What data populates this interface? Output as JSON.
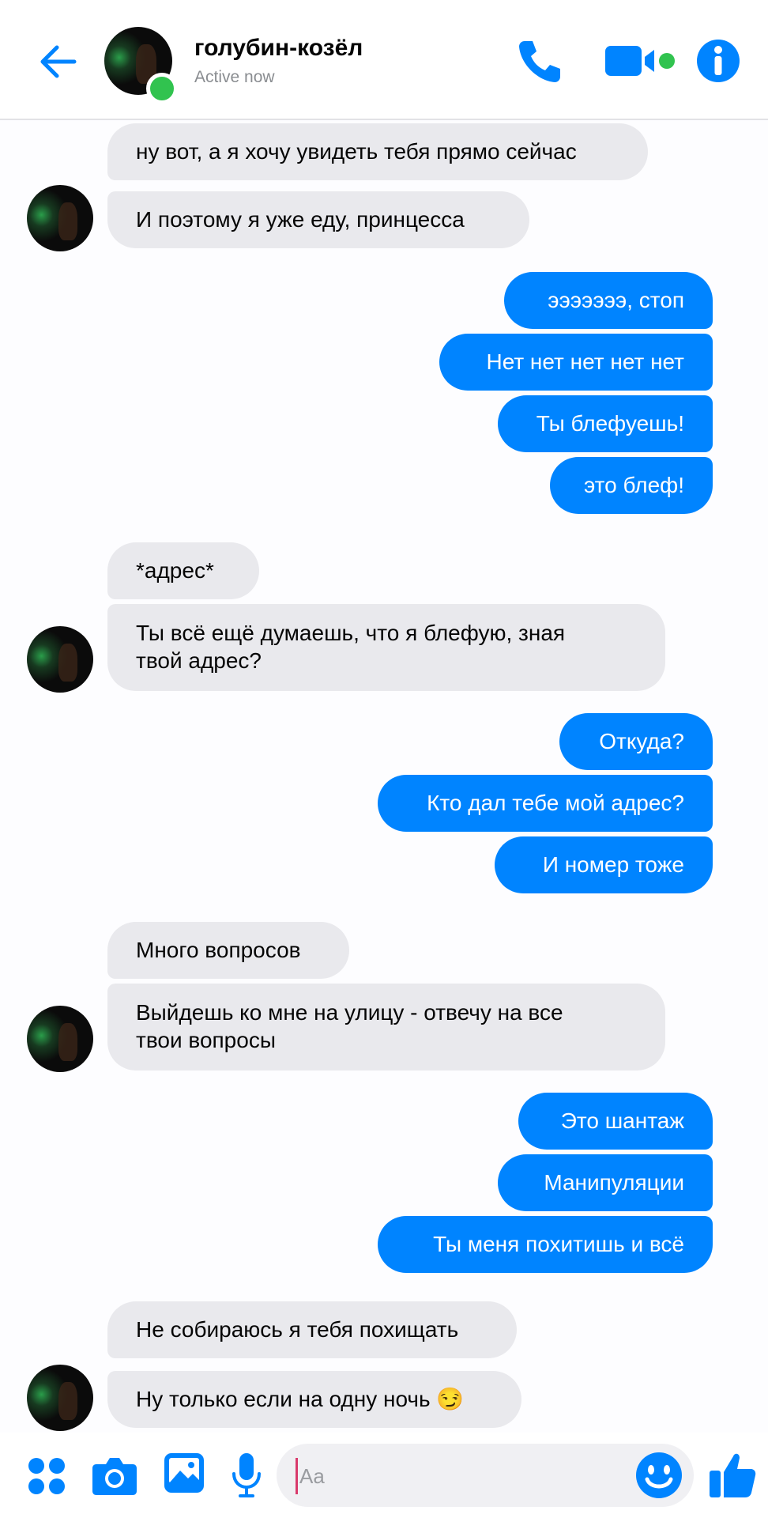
{
  "header": {
    "contact_name": "голубин-козёл",
    "status": "Active now",
    "icons": [
      "back-arrow-icon",
      "phone-icon",
      "video-camera-icon",
      "info-icon"
    ]
  },
  "colors": {
    "accent": "#0084ff",
    "incoming_bubble": "#e9e9ed",
    "online": "#31c34f"
  },
  "messages": [
    {
      "dir": "in",
      "text": "ну вот, а я хочу увидеть тебя прямо сейчас"
    },
    {
      "dir": "in",
      "text": "И поэтому я уже еду, принцесса"
    },
    {
      "dir": "out",
      "text": "эээээээ, стоп"
    },
    {
      "dir": "out",
      "text": "Нет нет нет нет нет"
    },
    {
      "dir": "out",
      "text": "Ты блефуешь!"
    },
    {
      "dir": "out",
      "text": "это блеф!"
    },
    {
      "dir": "in",
      "text": "*адрес*"
    },
    {
      "dir": "in",
      "text": "Ты всё ещё думаешь, что я блефую, зная\nтвой адрес?"
    },
    {
      "dir": "out",
      "text": "Откуда?"
    },
    {
      "dir": "out",
      "text": "Кто дал тебе мой адрес?"
    },
    {
      "dir": "out",
      "text": "И номер тоже"
    },
    {
      "dir": "in",
      "text": "Много вопросов"
    },
    {
      "dir": "in",
      "text": "Выйдешь ко мне на улицу - отвечу на все\nтвои вопросы"
    },
    {
      "dir": "out",
      "text": "Это шантаж"
    },
    {
      "dir": "out",
      "text": "Манипуляции"
    },
    {
      "dir": "out",
      "text": "Ты меня похитишь и всё"
    },
    {
      "dir": "in",
      "text": "Не собираюсь я тебя похищать"
    },
    {
      "dir": "in",
      "text": "Ну только если на одну ночь 😏"
    }
  ],
  "composer": {
    "placeholder": "Aa",
    "icons": [
      "apps-icon",
      "camera-icon",
      "gallery-icon",
      "microphone-icon",
      "emoji-icon",
      "thumbs-up-icon"
    ]
  }
}
